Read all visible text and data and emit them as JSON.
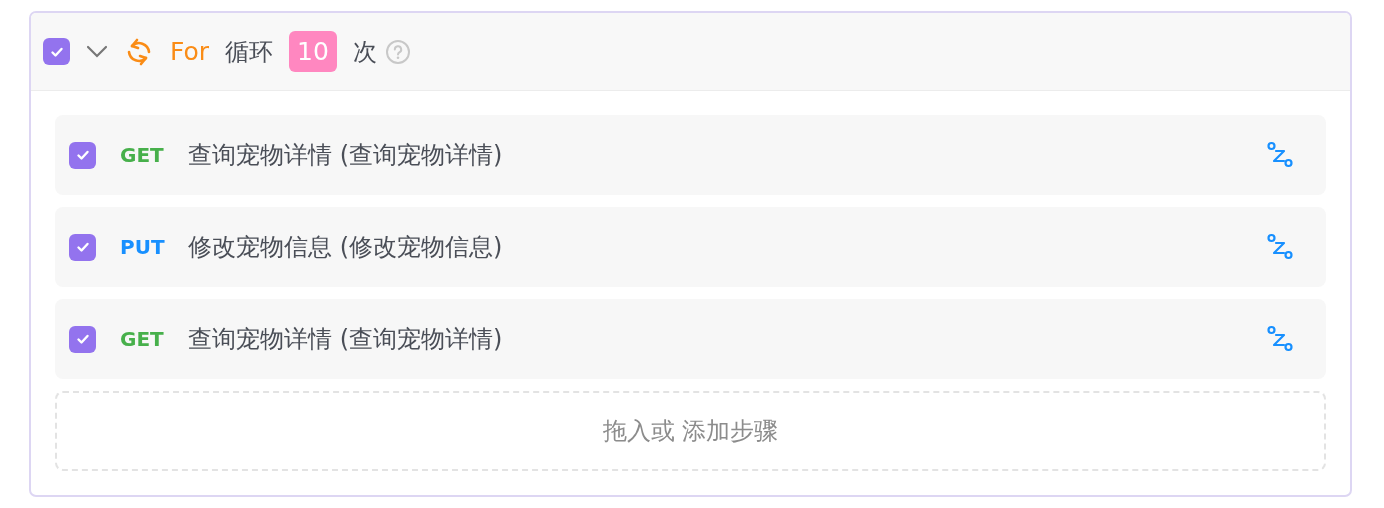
{
  "loop": {
    "checked": true,
    "expanded": true,
    "keyword": "For",
    "label": "循环",
    "count": "10",
    "unit": "次"
  },
  "steps": [
    {
      "checked": true,
      "method": "GET",
      "name": "查询宠物详情 (查询宠物详情)"
    },
    {
      "checked": true,
      "method": "PUT",
      "name": "修改宠物信息 (修改宠物信息)"
    },
    {
      "checked": true,
      "method": "GET",
      "name": "查询宠物详情 (查询宠物详情)"
    }
  ],
  "add_step": "拖入或 添加步骤"
}
